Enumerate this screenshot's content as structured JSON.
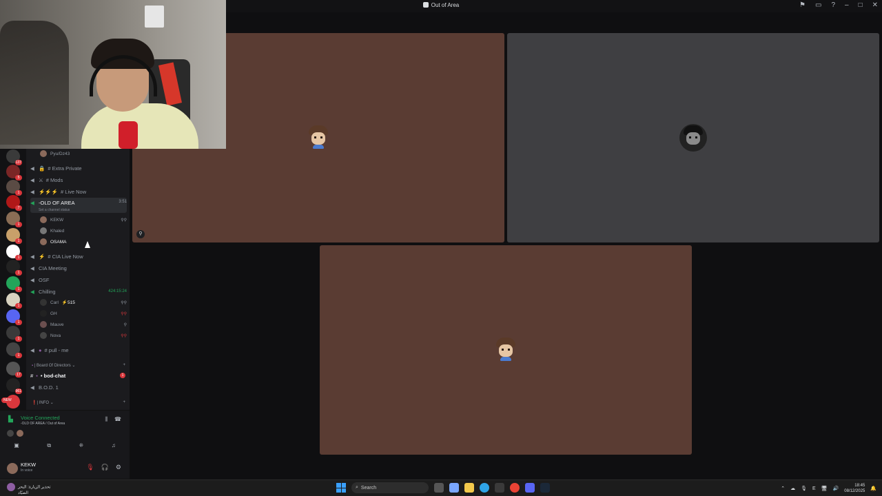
{
  "window": {
    "title": "Out of Area",
    "controls": [
      "flag-icon",
      "screen-icon",
      "help-icon",
      "minimize",
      "maximize",
      "close"
    ]
  },
  "servers": [
    {
      "badge": "137"
    },
    {
      "badge": "5"
    },
    {
      "badge": "1"
    },
    {
      "badge": "7"
    },
    {
      "badge": "1"
    },
    {
      "badge": "1"
    },
    {
      "badge": "1"
    },
    {
      "badge": "1"
    },
    {
      "badge": "1"
    },
    {
      "badge": "1"
    },
    {
      "badge": "1"
    },
    {
      "badge": "1"
    },
    {
      "badge": "1"
    },
    {
      "badge": "17"
    },
    {
      "badge": "961"
    },
    {
      "badge": "",
      "new": "NEW"
    }
  ],
  "channels": {
    "top_user": "Pyu/Dz43",
    "items": [
      {
        "label": "# Extra Private"
      },
      {
        "label": "# Mods"
      },
      {
        "label": "# Live Now"
      },
      {
        "label": "-OLD OF AREA",
        "time": "3:51",
        "status": "Set a channel status"
      },
      {
        "label": "# CIA Live Now"
      },
      {
        "label": "CIA Meeting"
      },
      {
        "label": "OSF"
      },
      {
        "label": "Chilling",
        "time": "424:15:24"
      },
      {
        "label": "# pull - me"
      }
    ],
    "voice_old_area": [
      "KEKW",
      "Khaled",
      "OSAMA"
    ],
    "voice_chilling": [
      {
        "name": "Carl",
        "extra": "⚡515"
      },
      {
        "name": "GH"
      },
      {
        "name": "Mauve"
      },
      {
        "name": "Nova"
      }
    ],
    "category_bod": "| Board Of Directors ⌄",
    "bod_chat": "• bod-chat",
    "bod_chat_badge": "1",
    "bod1": "B.O.D. 1",
    "category_info": "| INFO ⌄"
  },
  "voice_panel": {
    "title": "Voice Connected",
    "subtitle": "-OLD OF AREA / Out of Area"
  },
  "user_panel": {
    "name": "KEKW",
    "status": "In voice"
  },
  "taskbar": {
    "news_line1": "تحذير الزيارة: البحر",
    "news_line2": "الصيّاد",
    "search_placeholder": "Search",
    "time": "18:45",
    "date": "08/12/2025",
    "lang": "E"
  },
  "colors": {
    "tile_brown": "#5a3c33",
    "tile_grey": "#3f3f42",
    "green": "#23a55a",
    "red": "#da373c"
  }
}
